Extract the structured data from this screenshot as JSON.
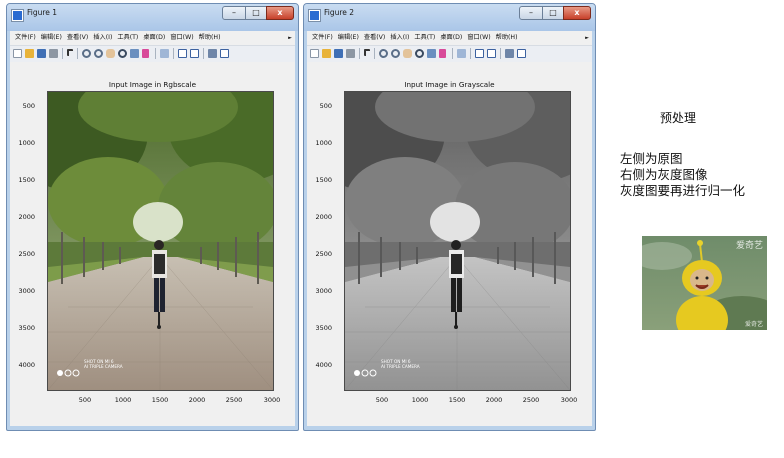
{
  "windows": [
    {
      "title": "Figure 1",
      "menu": [
        "文件(F)",
        "编辑(E)",
        "查看(V)",
        "插入(I)",
        "工具(T)",
        "桌面(D)",
        "窗口(W)",
        "帮助(H)"
      ],
      "axes_title": "Input Image in Rgbscale",
      "y_ticks": [
        "500",
        "1000",
        "1500",
        "2000",
        "2500",
        "3000",
        "3500",
        "4000"
      ],
      "x_ticks": [
        "500",
        "1000",
        "1500",
        "2000",
        "2500",
        "3000"
      ],
      "camera_text": [
        "SHOT ON MI 6",
        "AI TRIPLE CAMERA"
      ]
    },
    {
      "title": "Figure 2",
      "menu": [
        "文件(F)",
        "编辑(E)",
        "查看(V)",
        "插入(I)",
        "工具(T)",
        "桌面(D)",
        "窗口(W)",
        "帮助(H)"
      ],
      "axes_title": "Input Image in Grayscale",
      "y_ticks": [
        "500",
        "1000",
        "1500",
        "2000",
        "2500",
        "3000",
        "3500",
        "4000"
      ],
      "x_ticks": [
        "500",
        "1000",
        "1500",
        "2000",
        "2500",
        "3000"
      ],
      "camera_text": [
        "SHOT ON MI 6",
        "AI TRIPLE CAMERA"
      ]
    }
  ],
  "window_controls": {
    "minimize": "–",
    "maximize": "□",
    "close": "x"
  },
  "side_panel": {
    "title": "预处理",
    "lines": [
      "左侧为原图",
      "右侧为灰度图像",
      "灰度图要再进行归一化"
    ]
  },
  "thumbnail": {
    "watermark_top": "爱奇艺",
    "watermark_bottom": "爱奇艺"
  },
  "colors": {
    "title_bar": "#aac6e8",
    "figure_bg": "#f0f0f0",
    "close_button": "#c7402a"
  }
}
